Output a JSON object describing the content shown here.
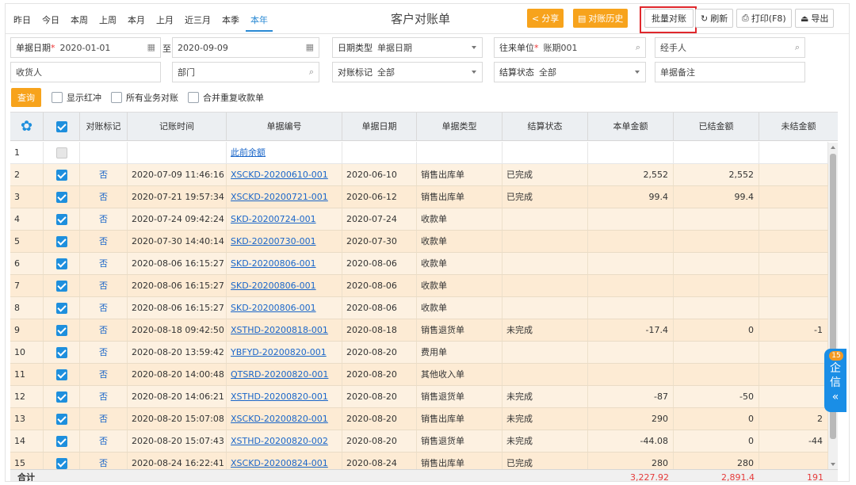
{
  "periods": [
    "昨日",
    "今日",
    "本周",
    "上周",
    "本月",
    "上月",
    "近三月",
    "本季",
    "本年"
  ],
  "active_period": "本年",
  "title": "客户对账单",
  "buttons": {
    "share": "分享",
    "history": "对账历史",
    "batch": "批量对账",
    "refresh": "刷新",
    "print": "打印(F8)",
    "export": "导出"
  },
  "filters": {
    "date_label": "单据日期",
    "date_from": "2020-01-01",
    "to": "至",
    "date_to": "2020-09-09",
    "date_type_label": "日期类型",
    "date_type_value": "单据日期",
    "unit_label": "往来单位",
    "unit_value": "账期001",
    "handler": "经手人",
    "receiver": "收货人",
    "dept": "部门",
    "mark_label": "对账标记",
    "mark_value": "全部",
    "settle_label": "结算状态",
    "settle_value": "全部",
    "remark": "单据备注"
  },
  "query_label": "查询",
  "options": [
    "显示红冲",
    "所有业务对账",
    "合并重复收款单"
  ],
  "columns": [
    "对账标记",
    "记账时间",
    "单据编号",
    "单据日期",
    "单据类型",
    "结算状态",
    "本单金额",
    "已结金额",
    "未结金额"
  ],
  "rows": [
    {
      "no": "1",
      "mark": "",
      "time": "",
      "code": "此前余额",
      "date": "",
      "type": "",
      "status": "",
      "amount": "",
      "settled": "",
      "unsettled": ""
    },
    {
      "no": "2",
      "mark": "否",
      "time": "2020-07-09 11:46:16",
      "code": "XSCKD-20200610-001",
      "date": "2020-06-10",
      "type": "销售出库单",
      "status": "已完成",
      "amount": "2,552",
      "settled": "2,552",
      "unsettled": ""
    },
    {
      "no": "3",
      "mark": "否",
      "time": "2020-07-21 19:57:34",
      "code": "XSCKD-20200721-001",
      "date": "2020-06-12",
      "type": "销售出库单",
      "status": "已完成",
      "amount": "99.4",
      "settled": "99.4",
      "unsettled": ""
    },
    {
      "no": "4",
      "mark": "否",
      "time": "2020-07-24 09:42:24",
      "code": "SKD-20200724-001",
      "date": "2020-07-24",
      "type": "收款单",
      "status": "",
      "amount": "",
      "settled": "",
      "unsettled": ""
    },
    {
      "no": "5",
      "mark": "否",
      "time": "2020-07-30 14:40:14",
      "code": "SKD-20200730-001",
      "date": "2020-07-30",
      "type": "收款单",
      "status": "",
      "amount": "",
      "settled": "",
      "unsettled": ""
    },
    {
      "no": "6",
      "mark": "否",
      "time": "2020-08-06 16:15:27",
      "code": "SKD-20200806-001",
      "date": "2020-08-06",
      "type": "收款单",
      "status": "",
      "amount": "",
      "settled": "",
      "unsettled": ""
    },
    {
      "no": "7",
      "mark": "否",
      "time": "2020-08-06 16:15:27",
      "code": "SKD-20200806-001",
      "date": "2020-08-06",
      "type": "收款单",
      "status": "",
      "amount": "",
      "settled": "",
      "unsettled": ""
    },
    {
      "no": "8",
      "mark": "否",
      "time": "2020-08-06 16:15:27",
      "code": "SKD-20200806-001",
      "date": "2020-08-06",
      "type": "收款单",
      "status": "",
      "amount": "",
      "settled": "",
      "unsettled": ""
    },
    {
      "no": "9",
      "mark": "否",
      "time": "2020-08-18 09:42:50",
      "code": "XSTHD-20200818-001",
      "date": "2020-08-18",
      "type": "销售退货单",
      "status": "未完成",
      "amount": "-17.4",
      "settled": "0",
      "unsettled": "-1"
    },
    {
      "no": "10",
      "mark": "否",
      "time": "2020-08-20 13:59:42",
      "code": "YBFYD-20200820-001",
      "date": "2020-08-20",
      "type": "费用单",
      "status": "",
      "amount": "",
      "settled": "",
      "unsettled": ""
    },
    {
      "no": "11",
      "mark": "否",
      "time": "2020-08-20 14:00:48",
      "code": "QTSRD-20200820-001",
      "date": "2020-08-20",
      "type": "其他收入单",
      "status": "",
      "amount": "",
      "settled": "",
      "unsettled": ""
    },
    {
      "no": "12",
      "mark": "否",
      "time": "2020-08-20 14:06:21",
      "code": "XSTHD-20200820-001",
      "date": "2020-08-20",
      "type": "销售退货单",
      "status": "未完成",
      "amount": "-87",
      "settled": "-50",
      "unsettled": ""
    },
    {
      "no": "13",
      "mark": "否",
      "time": "2020-08-20 15:07:08",
      "code": "XSCKD-20200820-001",
      "date": "2020-08-20",
      "type": "销售出库单",
      "status": "未完成",
      "amount": "290",
      "settled": "0",
      "unsettled": "2"
    },
    {
      "no": "14",
      "mark": "否",
      "time": "2020-08-20 15:07:43",
      "code": "XSTHD-20200820-002",
      "date": "2020-08-20",
      "type": "销售退货单",
      "status": "未完成",
      "amount": "-44.08",
      "settled": "0",
      "unsettled": "-44"
    },
    {
      "no": "15",
      "mark": "否",
      "time": "2020-08-24 16:22:41",
      "code": "XSCKD-20200824-001",
      "date": "2020-08-24",
      "type": "销售出库单",
      "status": "已完成",
      "amount": "280",
      "settled": "280",
      "unsettled": ""
    }
  ],
  "footer": {
    "label": "合计",
    "amount": "3,227.92",
    "settled": "2,891.4",
    "unsettled": "191"
  },
  "side_widget": {
    "badge": "15",
    "line1": "企",
    "line2": "信",
    "line3": "«"
  }
}
